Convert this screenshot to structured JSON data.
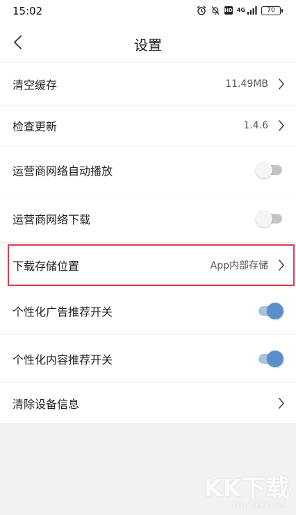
{
  "status_bar": {
    "time": "15:02",
    "network": "4G",
    "battery": "70"
  },
  "header": {
    "title": "设置"
  },
  "settings": [
    {
      "label": "清空缓存",
      "value": "11.49MB",
      "kind": "link"
    },
    {
      "label": "检查更新",
      "value": "1.4.6",
      "kind": "link"
    },
    {
      "label": "运营商网络自动播放",
      "kind": "toggle",
      "on": false
    },
    {
      "label": "运营商网络下载",
      "kind": "toggle",
      "on": false
    },
    {
      "label": "下载存储位置",
      "value": "App内部存储",
      "kind": "link",
      "highlighted": true
    },
    {
      "label": "个性化广告推荐开关",
      "kind": "toggle",
      "on": true
    },
    {
      "label": "个性化内容推荐开关",
      "kind": "toggle",
      "on": true
    },
    {
      "label": "清除设备信息",
      "value": "",
      "kind": "link"
    }
  ],
  "watermark": {
    "logo": "KK下载",
    "url": "www.kkx.net"
  },
  "colors": {
    "toggle_on": "#5b8fcc",
    "toggle_on_track": "#a9c3e3",
    "toggle_off_track": "#c4c4c4",
    "highlight": "#d93a4d"
  }
}
